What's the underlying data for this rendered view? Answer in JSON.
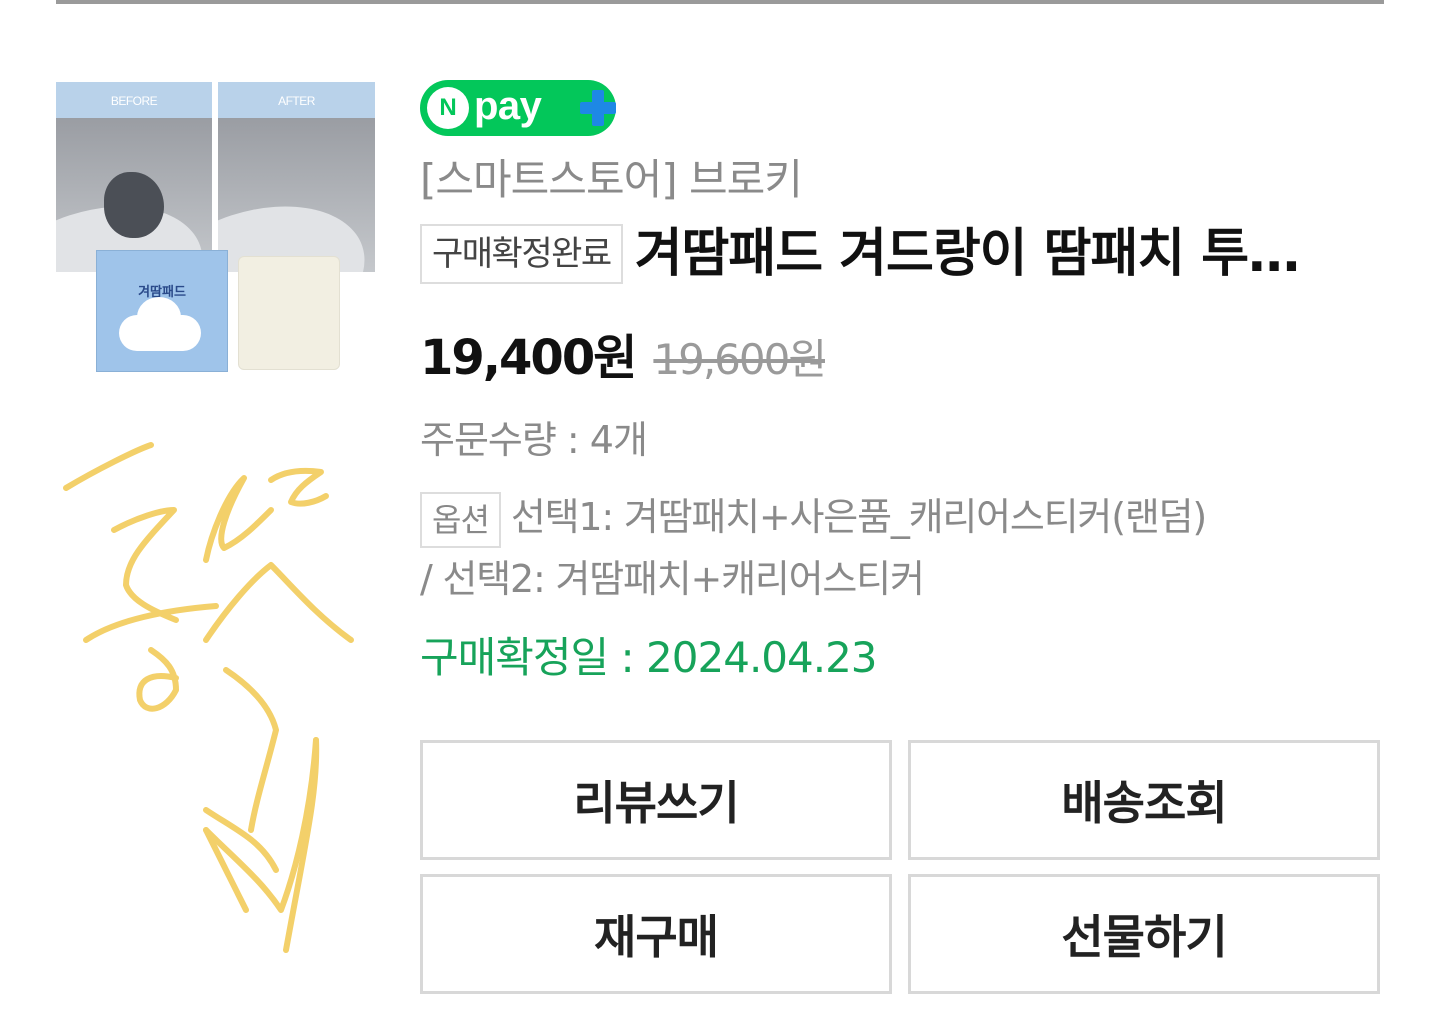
{
  "thumbnail": {
    "before_label": "BEFORE",
    "after_label": "AFTER",
    "box_label": "겨땀패드",
    "alt": "product-thumbnail"
  },
  "npay": {
    "n_letter": "N",
    "pay_text": "pay",
    "plus_color": "#1e88e5",
    "brand_color": "#03c75a"
  },
  "order": {
    "store": "[스마트스토어] 브로키",
    "status_badge": "구매확정완료",
    "title": "겨땀패드 겨드랑이 땀패치 투명 얇은 흡수 패드",
    "price": "19,400원",
    "original_price": "19,600원",
    "quantity": "주문수량 : 4개",
    "option_badge": "옵션",
    "option_line1": "선택1: 겨땀패치+사은품_캐리어스티커(랜덤)",
    "option_line2": "/ 선택2: 겨땀패치+캐리어스티커",
    "confirm_date": "구매확정일 : 2024.04.23"
  },
  "buttons": {
    "review": "리뷰쓰기",
    "track": "배송조회",
    "rebuy": "재구매",
    "gift": "선물하기"
  }
}
